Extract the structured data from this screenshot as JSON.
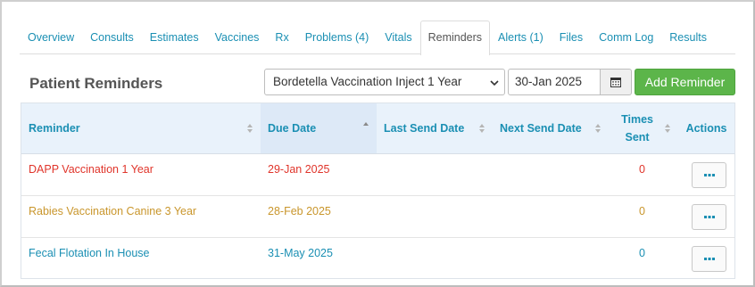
{
  "tabs": [
    {
      "label": "Overview",
      "active": false
    },
    {
      "label": "Consults",
      "active": false
    },
    {
      "label": "Estimates",
      "active": false
    },
    {
      "label": "Vaccines",
      "active": false
    },
    {
      "label": "Rx",
      "active": false
    },
    {
      "label": "Problems (4)",
      "active": false
    },
    {
      "label": "Vitals",
      "active": false
    },
    {
      "label": "Reminders",
      "active": true
    },
    {
      "label": "Alerts (1)",
      "active": false
    },
    {
      "label": "Files",
      "active": false
    },
    {
      "label": "Comm Log",
      "active": false
    },
    {
      "label": "Results",
      "active": false
    }
  ],
  "section": {
    "title": "Patient Reminders"
  },
  "controls": {
    "reminder_select": "Bordetella Vaccination Inject 1 Year",
    "date_value": "30-Jan 2025",
    "add_label": "Add Reminder"
  },
  "table": {
    "headers": {
      "reminder": "Reminder",
      "due_date": "Due Date",
      "last_send_date": "Last Send Date",
      "next_send_date": "Next Send Date",
      "times_sent_line1": "Times",
      "times_sent_line2": "Sent",
      "actions": "Actions"
    },
    "sorted_column": "due_date",
    "rows": [
      {
        "reminder": "DAPP Vaccination 1 Year",
        "due_date": "29-Jan 2025",
        "last_send_date": "",
        "next_send_date": "",
        "times_sent": "0",
        "status_color": "#e0342a"
      },
      {
        "reminder": "Rabies Vaccination Canine 3 Year",
        "due_date": "28-Feb 2025",
        "last_send_date": "",
        "next_send_date": "",
        "times_sent": "0",
        "status_color": "#c9962c"
      },
      {
        "reminder": "Fecal Flotation In House",
        "due_date": "31-May 2025",
        "last_send_date": "",
        "next_send_date": "",
        "times_sent": "0",
        "status_color": "#1a8fb3"
      }
    ]
  },
  "colors": {
    "link": "#1a8fb3",
    "success": "#5cb54a",
    "header_bg": "#e9f2fb"
  },
  "icons": {
    "calendar": "calendar-icon",
    "caret": "chevron-down-icon",
    "sort": "sort-icon",
    "more": "ellipsis-icon"
  }
}
